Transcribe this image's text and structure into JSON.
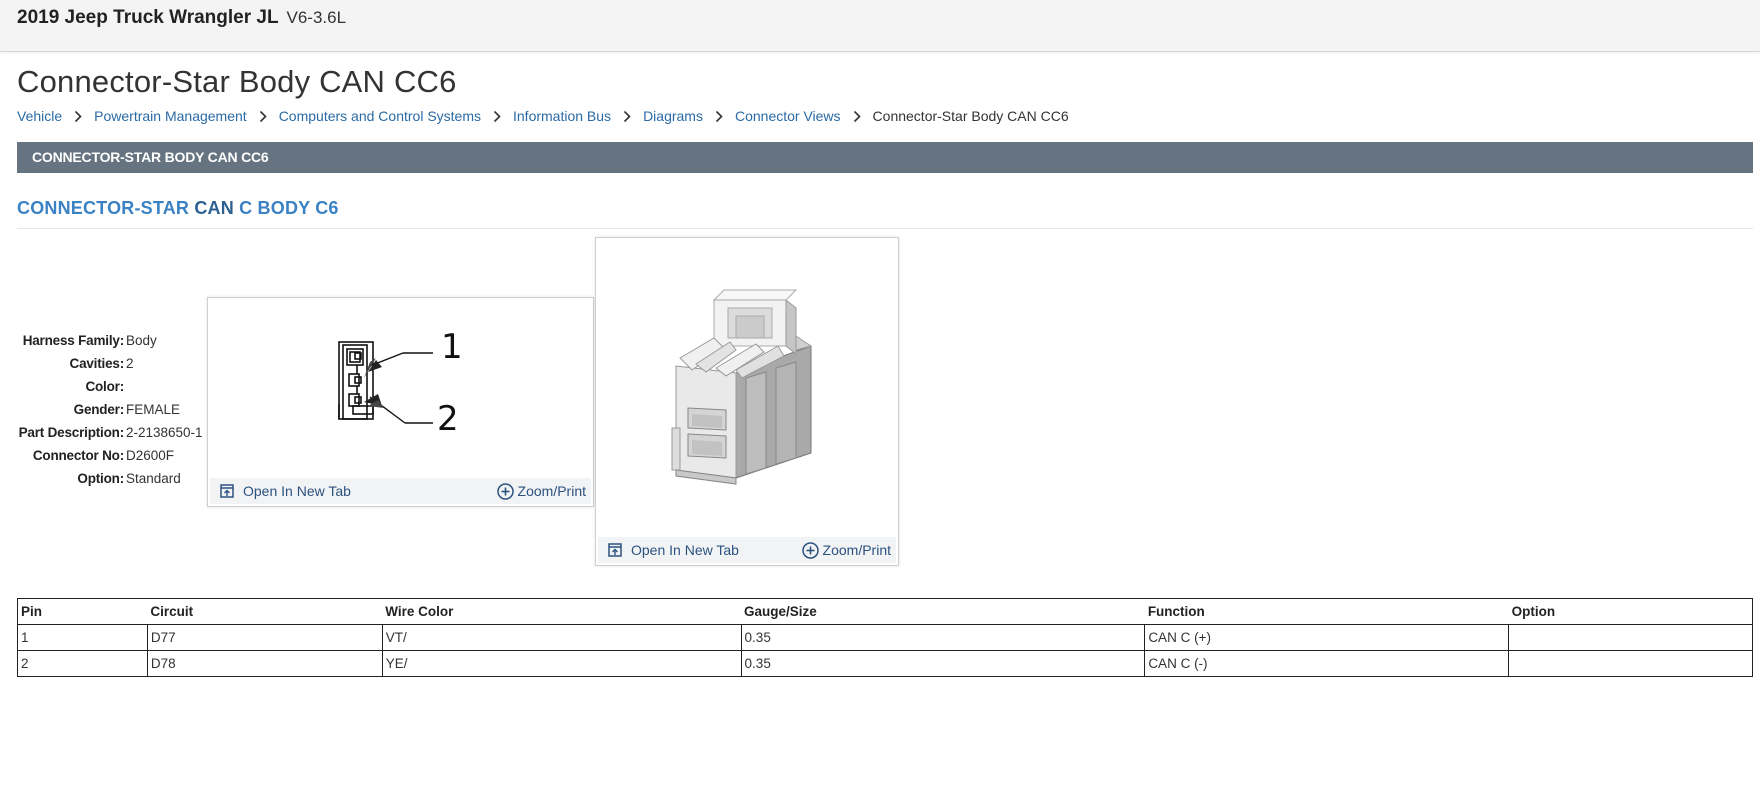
{
  "header": {
    "vehicle": "2019 Jeep Truck Wrangler JL",
    "engine": "V6-3.6L"
  },
  "page_title": "Connector-Star Body CAN CC6",
  "breadcrumb": [
    {
      "label": "Vehicle"
    },
    {
      "label": "Powertrain Management"
    },
    {
      "label": "Computers and Control Systems"
    },
    {
      "label": "Information Bus"
    },
    {
      "label": "Diagrams"
    },
    {
      "label": "Connector Views"
    },
    {
      "label": "Connector-Star Body CAN CC6"
    }
  ],
  "section_bar": "CONNECTOR-STAR BODY CAN CC6",
  "connector_heading": {
    "part1": "CONNECTOR-STAR ",
    "part2": "CAN",
    "part3": " C BODY C6"
  },
  "properties": [
    {
      "label": "Harness Family:",
      "value": "Body"
    },
    {
      "label": "Cavities:",
      "value": "2"
    },
    {
      "label": "Color:",
      "value": ""
    },
    {
      "label": "Gender:",
      "value": "FEMALE"
    },
    {
      "label": "Part Description:",
      "value": "2-2138650-1"
    },
    {
      "label": "Connector No:",
      "value": "D2600F"
    },
    {
      "label": "Option:",
      "value": "Standard"
    }
  ],
  "image_cards": [
    {
      "open_label": "Open In New Tab",
      "zoom_label": "Zoom/Print",
      "callouts": [
        "1",
        "2"
      ]
    },
    {
      "open_label": "Open In New Tab",
      "zoom_label": "Zoom/Print"
    }
  ],
  "pin_table": {
    "columns": [
      "Pin",
      "Circuit",
      "Wire Color",
      "Gauge/Size",
      "Function",
      "Option"
    ],
    "rows": [
      [
        "1",
        "D77",
        "VT/",
        "0.35",
        "CAN C (+)",
        ""
      ],
      [
        "2",
        "D78",
        "YE/",
        "0.35",
        "CAN C (-)",
        ""
      ]
    ]
  },
  "colors": {
    "link": "#2a6aa5",
    "section_bar": "#667380",
    "heading": "#3b82c4"
  },
  "icons": {
    "breadcrumb_separator": "chevron-right-icon",
    "open_tab": "open-new-tab-icon",
    "zoom": "zoom-plus-icon"
  }
}
